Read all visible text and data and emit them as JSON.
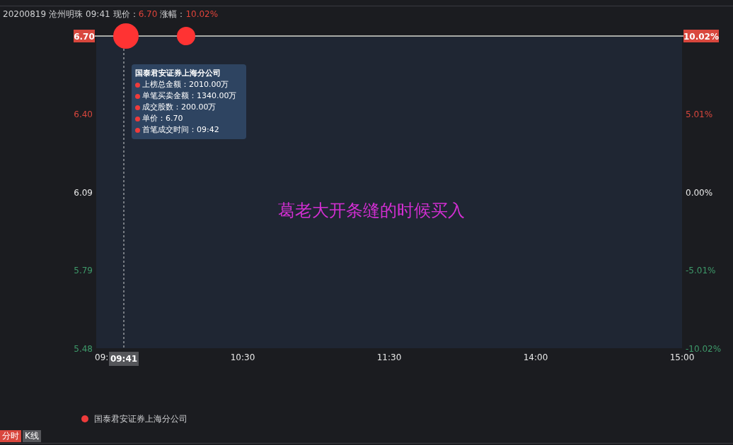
{
  "header": {
    "date": "20200819",
    "stock": "沧州明珠",
    "time": "09:41",
    "price_label": "现价：",
    "price": "6.70",
    "change_label": "涨幅：",
    "change": "10.02%"
  },
  "chart": {
    "left_axis": [
      {
        "label": "6.70",
        "color": "#d9473d",
        "highlighted": true
      },
      {
        "label": "6.40",
        "color": "#d9473d",
        "highlighted": false
      },
      {
        "label": "6.09",
        "color": "#e8e8e8",
        "highlighted": false
      },
      {
        "label": "5.79",
        "color": "#3e9a6a",
        "highlighted": false
      },
      {
        "label": "5.48",
        "color": "#3e9a6a",
        "highlighted": false
      }
    ],
    "right_axis": [
      {
        "label": "10.02%",
        "color": "#d9473d",
        "highlighted": true
      },
      {
        "label": "5.01%",
        "color": "#d9473d",
        "highlighted": false
      },
      {
        "label": "0.00%",
        "color": "#e8e8e8",
        "highlighted": false
      },
      {
        "label": "-5.01%",
        "color": "#3e9a6a",
        "highlighted": false
      },
      {
        "label": "-10.02%",
        "color": "#3e9a6a",
        "highlighted": false
      }
    ],
    "time_axis": [
      "09:",
      "10:30",
      "11:30",
      "14:00",
      "15:00"
    ],
    "crosshair_label": "09:41",
    "annotation": "葛老大开条缝的时候买入",
    "tooltip": {
      "title": "国泰君安证券上海分公司",
      "rows": [
        "上榜总金额：2010.00万",
        "单笔买卖金额：1340.00万",
        "成交股数：200.00万",
        "单价：6.70",
        "首笔成交时间：09:42"
      ]
    }
  },
  "legend": [
    {
      "label": "国泰君安证券上海分公司",
      "color": "#ee3b3b"
    }
  ],
  "tabs": [
    {
      "label": "分时",
      "selected": true
    },
    {
      "label": "K线",
      "selected": false
    }
  ]
}
